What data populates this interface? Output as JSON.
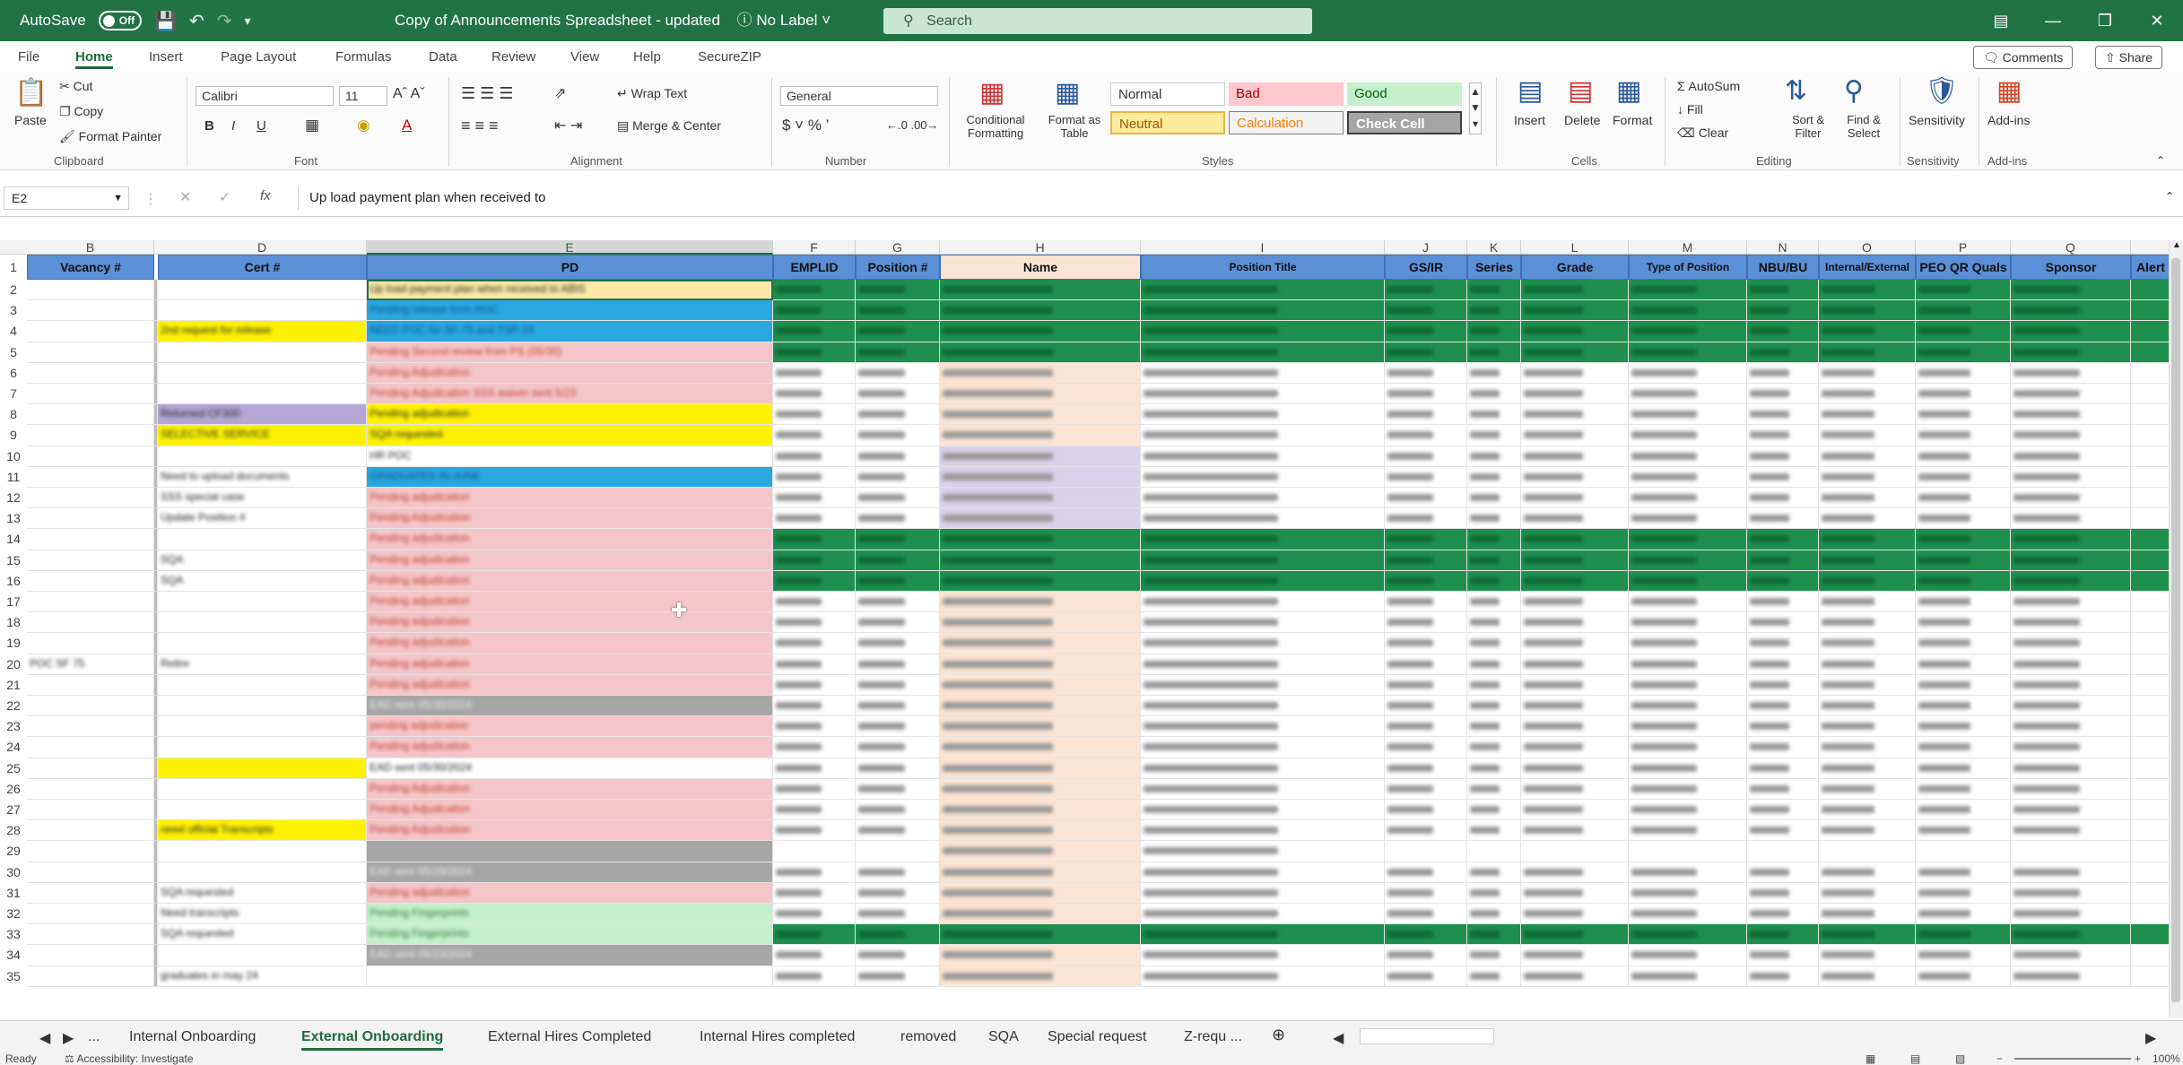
{
  "titlebar": {
    "autosave_label": "AutoSave",
    "autosave_state": "Off",
    "document_title": "Copy of Announcements Spreadsheet - updated",
    "label_status": "No Label",
    "search_placeholder": "Search"
  },
  "menu": {
    "tabs": [
      "File",
      "Home",
      "Insert",
      "Page Layout",
      "Formulas",
      "Data",
      "Review",
      "View",
      "Help",
      "SecureZIP"
    ],
    "comments_label": "Comments",
    "share_label": "Share"
  },
  "ribbon": {
    "clipboard": {
      "paste": "Paste",
      "cut": "Cut",
      "copy": "Copy",
      "format_painter": "Format Painter",
      "group": "Clipboard"
    },
    "font": {
      "name": "Calibri",
      "size": "11",
      "group": "Font"
    },
    "alignment": {
      "wrap": "Wrap Text",
      "merge": "Merge & Center",
      "group": "Alignment"
    },
    "number": {
      "format": "General",
      "group": "Number"
    },
    "styles": {
      "conditional": "Conditional Formatting",
      "format_table": "Format as Table",
      "normal": "Normal",
      "bad": "Bad",
      "good": "Good",
      "neutral": "Neutral",
      "calculation": "Calculation",
      "check_cell": "Check Cell",
      "group": "Styles"
    },
    "cells": {
      "insert": "Insert",
      "delete": "Delete",
      "format": "Format",
      "group": "Cells"
    },
    "editing": {
      "autosum": "AutoSum",
      "fill": "Fill",
      "clear": "Clear",
      "sort": "Sort & Filter",
      "find": "Find & Select",
      "group": "Editing"
    },
    "sensitivity": {
      "label": "Sensitivity",
      "group": "Sensitivity"
    },
    "addins": {
      "label": "Add-ins",
      "group": "Add-ins"
    }
  },
  "formula_bar": {
    "name_box": "E2",
    "fx": "fx",
    "content": "Up load payment plan when received to"
  },
  "columns": {
    "letters": [
      "B",
      "D",
      "E",
      "F",
      "G",
      "H",
      "I",
      "J",
      "K",
      "L",
      "M",
      "N",
      "O",
      "P",
      "Q"
    ],
    "headers": [
      "Vacancy #",
      "Cert #",
      "PD",
      "EMPLID",
      "Position #",
      "Name",
      "Position Title",
      "GS/IR",
      "Series",
      "Grade",
      "Type of Position",
      "NBU/BU",
      "Internal/External",
      "PEO QR Quals",
      "Sponsor",
      "Alert"
    ]
  },
  "rows": [
    {
      "n": "2",
      "B": "",
      "D": "",
      "E": "Up load payment plan when received to ABIS"
    },
    {
      "n": "3",
      "B": "",
      "D": "",
      "E": "Pending release from ROC"
    },
    {
      "n": "4",
      "B": "",
      "D": "2nd request for release",
      "E": "NEED POC for SF-75 and TSP-19"
    },
    {
      "n": "5",
      "B": "",
      "D": "",
      "E": "Pending Second review from PS (05/30)"
    },
    {
      "n": "6",
      "B": "",
      "D": "",
      "E": "Pending Adjudication"
    },
    {
      "n": "7",
      "B": "",
      "D": "",
      "E": "Pending Adjudication SSS waiver sent 5/23"
    },
    {
      "n": "8",
      "B": "",
      "D": "Returned CF300",
      "E": "Pending adjudication"
    },
    {
      "n": "9",
      "B": "",
      "D": "SELECTIVE SERVICE",
      "E": "SQA requested"
    },
    {
      "n": "10",
      "B": "",
      "D": "",
      "E": "HR POC"
    },
    {
      "n": "11",
      "B": "",
      "D": "Need to upload documents",
      "E": "GRADUATES IN JUNE"
    },
    {
      "n": "12",
      "B": "",
      "D": "SSS special case",
      "E": "Pending adjudication"
    },
    {
      "n": "13",
      "B": "",
      "D": "Update Position #",
      "E": "Pending Adjudication"
    },
    {
      "n": "14",
      "B": "",
      "D": "",
      "E": "Pending adjudication"
    },
    {
      "n": "15",
      "B": "",
      "D": "SQA",
      "E": "Pending adjudication"
    },
    {
      "n": "16",
      "B": "",
      "D": "SQA",
      "E": "Pending adjudication"
    },
    {
      "n": "17",
      "B": "",
      "D": "",
      "E": "Pending adjudication"
    },
    {
      "n": "18",
      "B": "",
      "D": "",
      "E": "Pending adjudication"
    },
    {
      "n": "19",
      "B": "",
      "D": "",
      "E": "Pending adjudication"
    },
    {
      "n": "20",
      "B": "POC SF 75",
      "D": "Retire",
      "E": "Pending adjudication"
    },
    {
      "n": "21",
      "B": "",
      "D": "",
      "E": "Pending adjudication"
    },
    {
      "n": "22",
      "B": "",
      "D": "",
      "E": "EAD sent 05/30/2024"
    },
    {
      "n": "23",
      "B": "",
      "D": "",
      "E": "pending adjudication"
    },
    {
      "n": "24",
      "B": "",
      "D": "",
      "E": "Pending adjudication"
    },
    {
      "n": "25",
      "B": "",
      "D": "",
      "E": "EAD sent 05/30/2024"
    },
    {
      "n": "26",
      "B": "",
      "D": "",
      "E": "Pending Adjudication"
    },
    {
      "n": "27",
      "B": "",
      "D": "",
      "E": "Pending Adjudication"
    },
    {
      "n": "28",
      "B": "",
      "D": "need official Transcripts",
      "E": "Pending Adjudication"
    },
    {
      "n": "29",
      "B": "",
      "D": "",
      "E": ""
    },
    {
      "n": "30",
      "B": "",
      "D": "",
      "E": "EAD sent 05/29/2024"
    },
    {
      "n": "31",
      "B": "",
      "D": "SQA requested",
      "E": "Pending adjudication"
    },
    {
      "n": "32",
      "B": "",
      "D": "Need transcripts",
      "E": "Pending Fingerprints"
    },
    {
      "n": "33",
      "B": "",
      "D": "SQA requested",
      "E": "Pending Fingerprints"
    },
    {
      "n": "34",
      "B": "",
      "D": "",
      "E": "EAD sent 05/23/2024"
    },
    {
      "n": "35",
      "B": "",
      "D": "graduates in may 24",
      "E": ""
    }
  ],
  "sheet_tabs": [
    "Internal Onboarding",
    "External Onboarding",
    "External Hires Completed",
    "Internal Hires completed",
    "removed",
    "SQA",
    "Special request",
    "Z-requ ..."
  ],
  "active_sheet": "External Onboarding",
  "status": {
    "ready": "Ready",
    "accessibility": "Accessibility: Investigate",
    "zoom": "100%"
  },
  "colors": {
    "excel_green": "#217346",
    "header_blue": "#5b8fd6",
    "row_green": "#1f8f4e",
    "pink": "#f4c6c9",
    "yellow": "#fff200",
    "cyan": "#29a8e0",
    "grey": "#a6a6a6",
    "peach": "#fbe4d3",
    "lavender": "#d9d2ea"
  }
}
